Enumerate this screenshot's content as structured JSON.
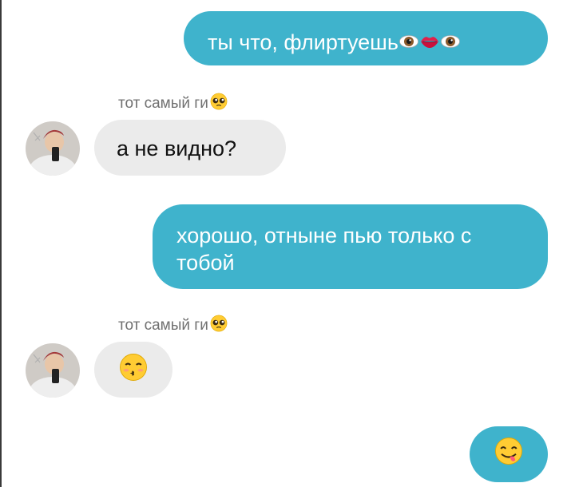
{
  "messages": [
    {
      "direction": "outgoing",
      "text": "ты что, флиртуешь",
      "emojis": [
        "eye-emoji",
        "lips-emoji",
        "eye-emoji"
      ]
    },
    {
      "direction": "incoming",
      "sender": "тот самый ги",
      "sender_emoji": "pleading-face-emoji",
      "text": "а не видно?"
    },
    {
      "direction": "outgoing",
      "text": "хорошо, отныне пью только с тобой"
    },
    {
      "direction": "incoming",
      "sender": "тот самый ги",
      "sender_emoji": "pleading-face-emoji",
      "emoji": "kissing-smiling-eyes-emoji"
    },
    {
      "direction": "outgoing",
      "emoji": "savoring-food-emoji"
    }
  ],
  "colors": {
    "outgoing_bubble": "#3fb3cc",
    "incoming_bubble": "#ebebeb",
    "sender_name": "#707070"
  }
}
